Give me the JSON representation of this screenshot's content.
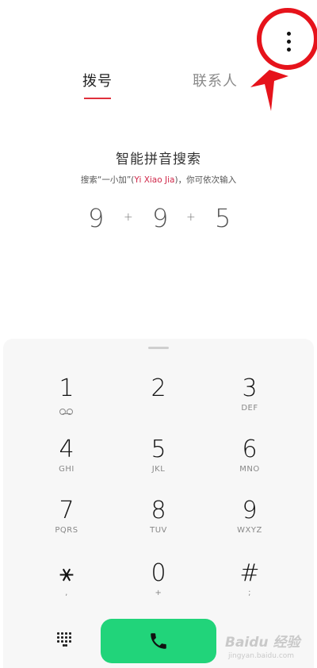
{
  "tabs": {
    "dial": "拨号",
    "contacts": "联系人"
  },
  "search_hint": {
    "title": "智能拼音搜索",
    "sub_before": "搜索“一小加”(",
    "sub_pinyin": "Yi Xiao Jia",
    "sub_after": ")，你可依次输入"
  },
  "typed_sequence": {
    "d1": "9",
    "p1": "+",
    "d2": "9",
    "p2": "+",
    "d3": "5"
  },
  "keys": [
    {
      "num": "1",
      "sub": ""
    },
    {
      "num": "2",
      "sub": ""
    },
    {
      "num": "3",
      "sub": "DEF"
    },
    {
      "num": "4",
      "sub": "GHI"
    },
    {
      "num": "5",
      "sub": "JKL"
    },
    {
      "num": "6",
      "sub": "MNO"
    },
    {
      "num": "7",
      "sub": "PQRS"
    },
    {
      "num": "8",
      "sub": "TUV"
    },
    {
      "num": "9",
      "sub": "WXYZ"
    },
    {
      "num": "⚹",
      "sub": ","
    },
    {
      "num": "0",
      "sub": "+"
    },
    {
      "num": "#",
      "sub": ";"
    }
  ],
  "icons": {
    "more": "more-vertical-icon",
    "voicemail": "voicemail-icon",
    "dialpad": "dialpad-grid-icon",
    "call": "phone-icon"
  },
  "colors": {
    "accent_red": "#e6131b",
    "tab_underline": "#e0303c",
    "call_green": "#21d47a"
  },
  "watermark": {
    "main": "Baidu 经验",
    "url": "jingyan.baidu.com"
  }
}
